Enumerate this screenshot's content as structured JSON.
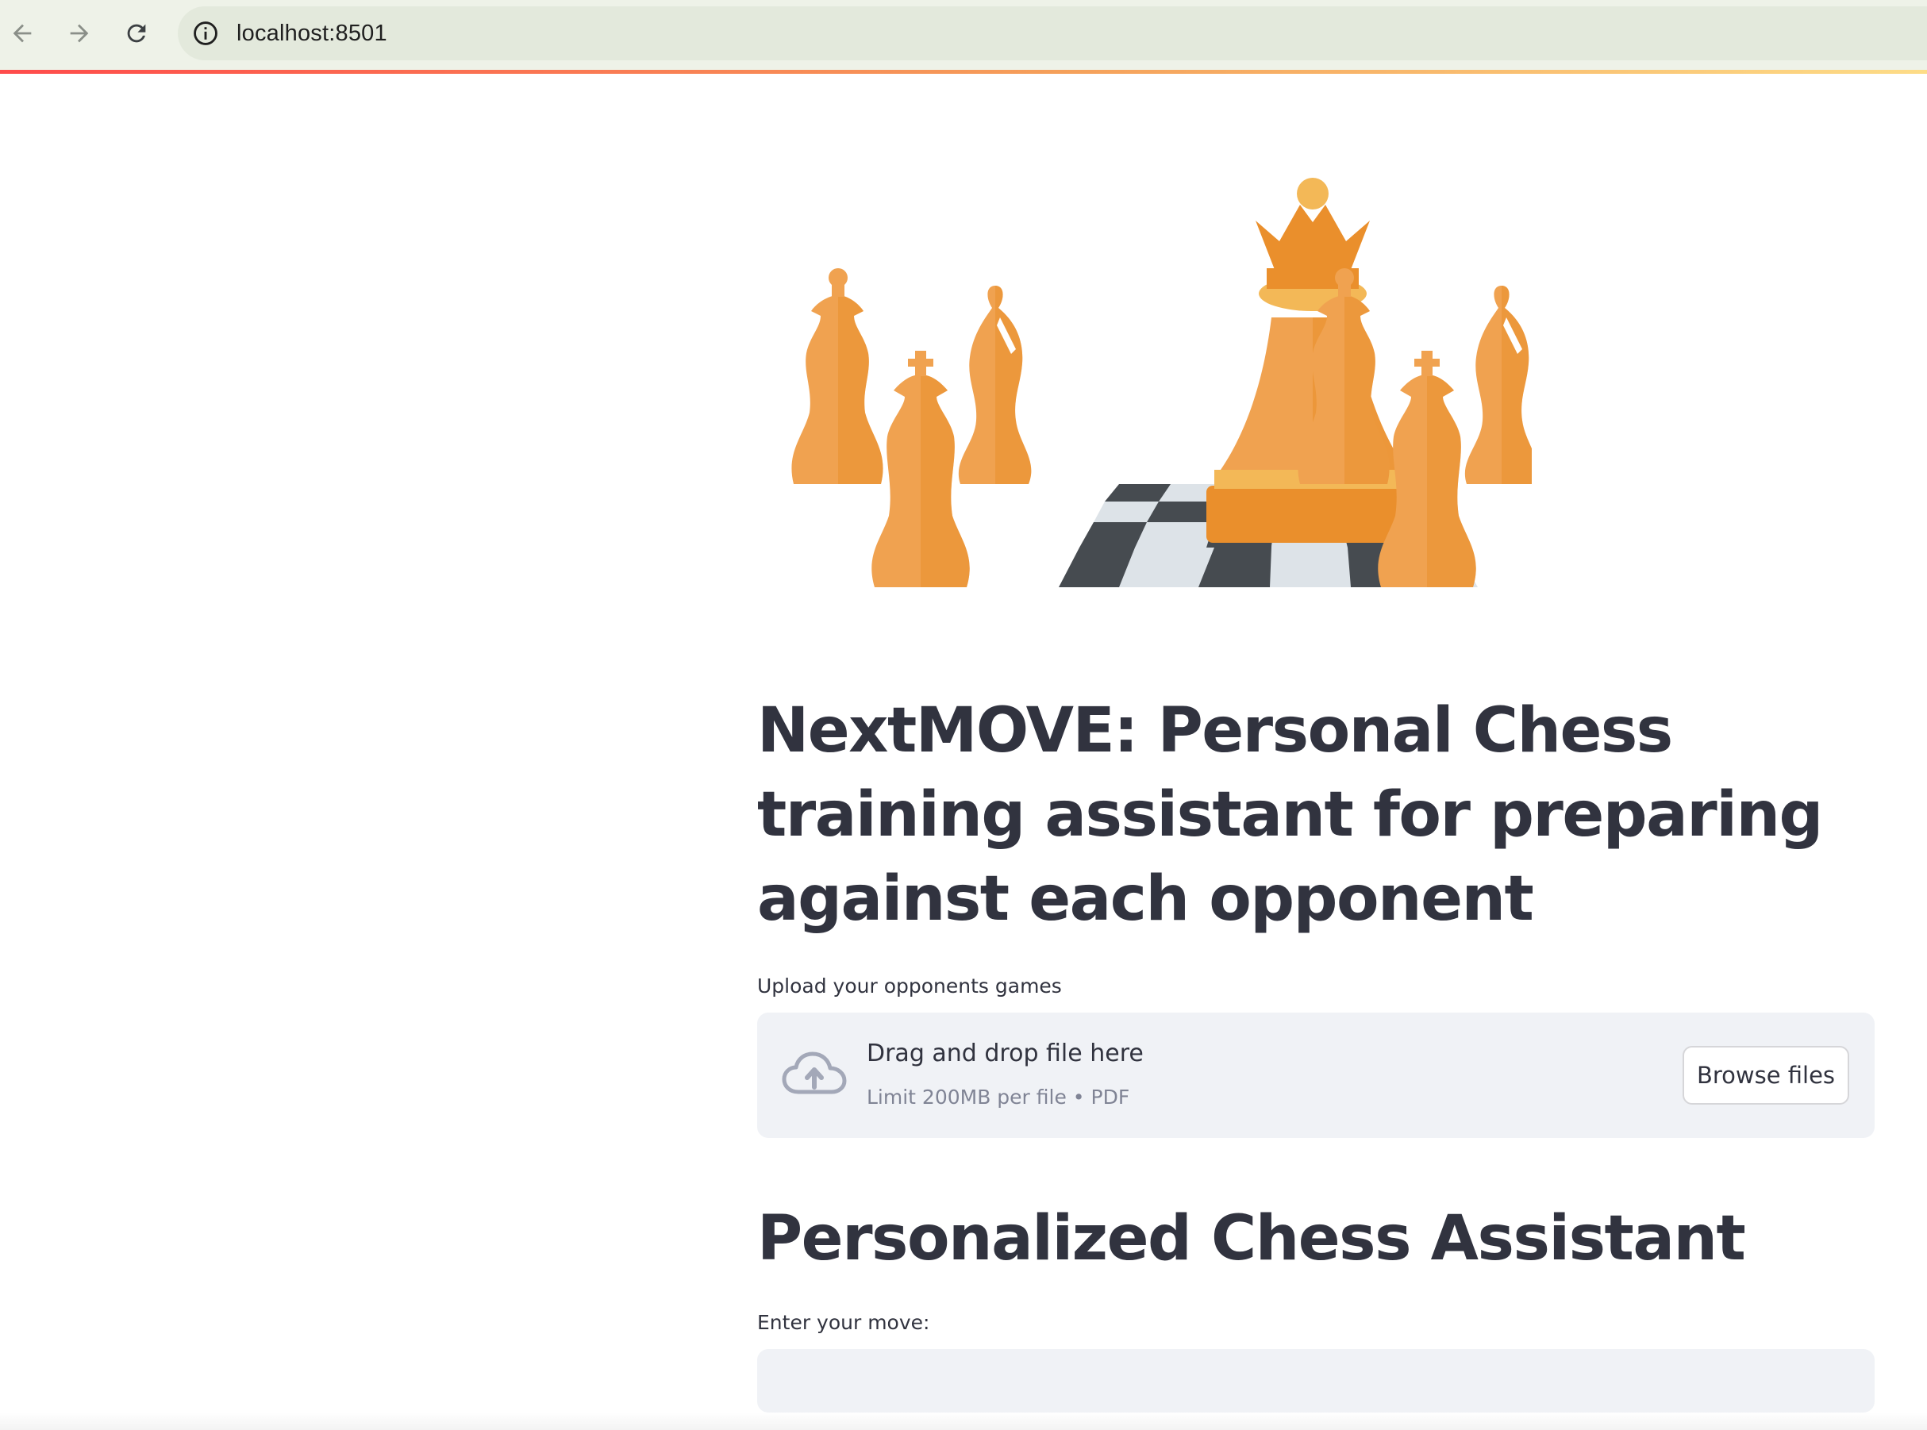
{
  "browser": {
    "url": "localhost:8501",
    "back_icon": "arrow-left-icon",
    "forward_icon": "arrow-right-icon",
    "reload_icon": "reload-icon",
    "site_info_icon": "info-icon"
  },
  "hero_image": {
    "icon": "chess-pieces-illustration",
    "accent_color": "#f0a250",
    "board_dark": "#464b50",
    "board_light": "#dde3e8"
  },
  "main": {
    "title": "NextMOVE: Personal Chess training assistant for preparing against each opponent",
    "upload_label": "Upload your opponents games",
    "uploader": {
      "icon": "cloud-upload-icon",
      "drop_text": "Drag and drop file here",
      "limit_text": "Limit 200MB per file • PDF",
      "browse_label": "Browse files"
    },
    "subtitle": "Personalized Chess Assistant",
    "move_label": "Enter your move:",
    "move_value": ""
  }
}
